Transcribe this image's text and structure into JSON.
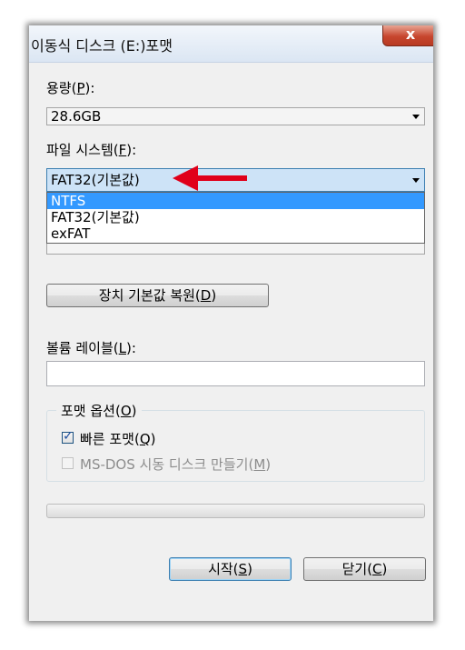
{
  "window": {
    "title": "이동식 디스크 (E:)포맷",
    "close_glyph": "x"
  },
  "capacity": {
    "label_pre": "용량(",
    "label_key": "P",
    "label_post": "):",
    "value": "28.6GB"
  },
  "filesystem": {
    "label_pre": "파일 시스템(",
    "label_key": "F",
    "label_post": "):",
    "value": "FAT32(기본값)",
    "options": [
      "NTFS",
      "FAT32(기본값)",
      "exFAT"
    ],
    "highlighted_option": "NTFS"
  },
  "restore_button": {
    "label_pre": "장치 기본값 복원(",
    "label_key": "D",
    "label_post": ")"
  },
  "volume": {
    "label_pre": "볼륨 레이블(",
    "label_key": "L",
    "label_post": "):",
    "value": ""
  },
  "format_options": {
    "title_pre": "포맷 옵션(",
    "title_key": "O",
    "title_post": ")",
    "quick_format": {
      "label_pre": "빠른 포맷(",
      "label_key": "Q",
      "label_post": ")",
      "checked": true
    },
    "msdos": {
      "label_pre": "MS-DOS 시동 디스크 만들기(",
      "label_key": "M",
      "label_post": ")",
      "checked": false,
      "enabled": false
    }
  },
  "progress": {
    "fraction": 0
  },
  "start_button": {
    "label_pre": "시작(",
    "label_key": "S",
    "label_post": ")"
  },
  "close_button": {
    "label_pre": "닫기(",
    "label_key": "C",
    "label_post": ")"
  },
  "colors": {
    "annotation_arrow": "#e0001a",
    "highlight": "#3399ff"
  }
}
